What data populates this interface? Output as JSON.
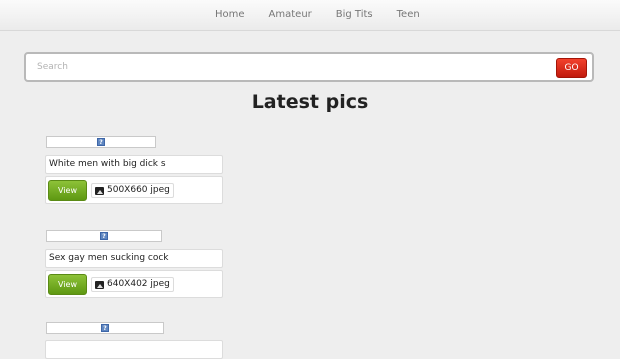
{
  "nav": {
    "items": [
      {
        "label": "Home"
      },
      {
        "label": "Amateur"
      },
      {
        "label": "Big Tits"
      },
      {
        "label": "Teen"
      }
    ]
  },
  "search": {
    "placeholder": "Search",
    "go_label": "GO"
  },
  "heading": "Latest pics",
  "pics": [
    {
      "title": "White men with big dick s",
      "view_label": "View",
      "meta": "500X660 jpeg"
    },
    {
      "title": "Sex gay men sucking cock",
      "view_label": "View",
      "meta": "640X402 jpeg"
    }
  ],
  "broken_image_glyph": "?",
  "colors": {
    "go_button": "#d42514",
    "view_button": "#6ba51d",
    "background": "#eeeeee"
  }
}
